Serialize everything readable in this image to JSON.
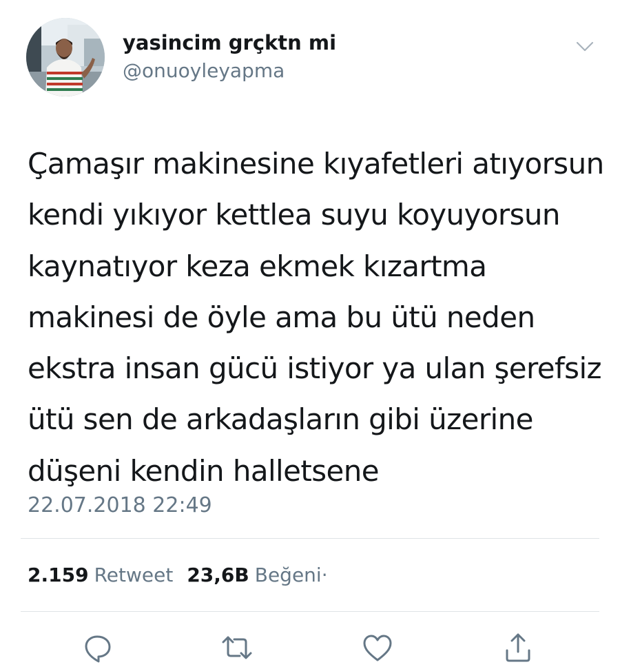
{
  "tweet": {
    "author": {
      "display_name": "yasincim grçktn mi",
      "handle": "@onuoyleyapma"
    },
    "text": "Çamaşır makinesine kıyafetleri atıyorsun\nkendi yıkıyor kettlea suyu koyuyorsun\nkaynatıyor keza ekmek kızartma\nmakinesi de öyle ama bu ütü neden\nekstra insan gücü istiyor ya ulan şerefsiz\nütü sen de arkadaşların gibi üzerine\ndüşeni kendin halletsene",
    "timestamp": "22.07.2018 22:49",
    "stats": {
      "retweet_count": "2.159",
      "retweet_label": "Retweet",
      "like_count": "23,6B",
      "like_label": "Beğeni",
      "trailing_mark": "·"
    }
  },
  "icons": {
    "menu": "chevron-down-icon",
    "reply": "reply-icon",
    "retweet": "retweet-icon",
    "like": "heart-icon",
    "share": "share-icon"
  },
  "colors": {
    "text": "#14171a",
    "secondary": "#657786",
    "divider": "#dfe3e6",
    "icon": "#657786"
  }
}
